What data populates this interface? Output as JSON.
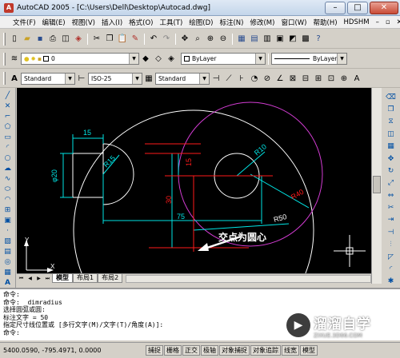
{
  "window": {
    "title": "AutoCAD 2005 - [C:\\Users\\Dell\\Desktop\\Autocad.dwg]",
    "minimize": "–",
    "maximize": "□",
    "close": "✕"
  },
  "menu": {
    "items": [
      "文件(F)",
      "编辑(E)",
      "视图(V)",
      "插入(I)",
      "格式(O)",
      "工具(T)",
      "绘图(D)",
      "标注(N)",
      "修改(M)",
      "窗口(W)",
      "帮助(H)",
      "HDSHM"
    ],
    "doc_minimize": "–",
    "doc_restore": "▫",
    "doc_close": "✕"
  },
  "layers": {
    "current_layer": "0",
    "color": "ByLayer",
    "linetype": "ByLayer"
  },
  "styles": {
    "text_style": "Standard",
    "dim_style": "ISO-25",
    "table_style": "Standard"
  },
  "drawing": {
    "dim_15_top": "15",
    "dim_phi20": "φ20",
    "dim_r15": "R15",
    "dim_r10": "R10",
    "dim_15_vert": "15",
    "dim_30": "30",
    "dim_75": "75",
    "dim_r40": "R40",
    "dim_r50": "R50",
    "annotation": "交点为圆心",
    "ucs_y": "Y",
    "ucs_x": "X"
  },
  "tabs": {
    "items": [
      "模型",
      "布局1",
      "布局2"
    ]
  },
  "command": {
    "lines": [
      "命令:",
      "命令:  _dimradius",
      "选择圆弧或圆:",
      "标注文字 = 50",
      "指定尺寸线位置或 [多行文字(M)/文字(T)/角度(A)]:",
      "命令:"
    ]
  },
  "status": {
    "coords": "5400.0590, -795.4971, 0.0000",
    "buttons": [
      "捕捉",
      "栅格",
      "正交",
      "极轴",
      "对象捕捉",
      "对象追踪",
      "线宽",
      "模型"
    ]
  },
  "watermark": {
    "logo_glyph": "▶",
    "title": "溜溜自学",
    "subtitle": "ZIXUE.3D66.COM"
  },
  "colors": {
    "cyan": "#00e5e5",
    "red": "#ff1a1a",
    "magenta": "#d23cd2",
    "white": "#ffffff"
  }
}
